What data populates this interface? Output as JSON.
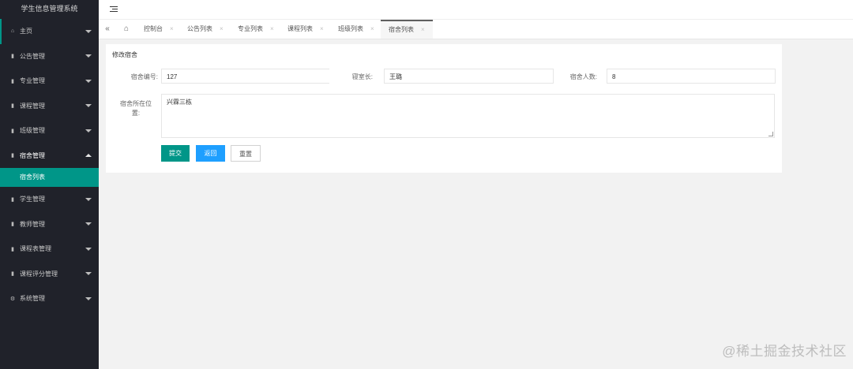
{
  "sidebar": {
    "title": "学生信息管理系统",
    "items": [
      {
        "icon": "⌂",
        "label": "主页"
      },
      {
        "icon": "▮",
        "label": "公告管理"
      },
      {
        "icon": "▮",
        "label": "专业管理"
      },
      {
        "icon": "▮",
        "label": "课程管理"
      },
      {
        "icon": "▮",
        "label": "班级管理"
      },
      {
        "icon": "▮",
        "label": "宿舍管理"
      },
      {
        "icon": "▮",
        "label": "学生管理"
      },
      {
        "icon": "▮",
        "label": "教师管理"
      },
      {
        "icon": "▮",
        "label": "课程表管理"
      },
      {
        "icon": "▮",
        "label": "课程评分管理"
      },
      {
        "icon": "⚙",
        "label": "系统管理"
      }
    ],
    "sub_active": "宿舍列表"
  },
  "tabs": {
    "prev_glyph": "«",
    "home_glyph": "⌂",
    "close_glyph": "×",
    "items": [
      "控制台",
      "公告列表",
      "专业列表",
      "课程列表",
      "班级列表",
      "宿舍列表"
    ]
  },
  "form": {
    "title": "修改宿舍",
    "labels": {
      "dorm_no": "宿舍编号:",
      "leader": "寝室长:",
      "count": "宿舍人数:",
      "location": "宿舍所在位置:"
    },
    "values": {
      "dorm_no": "127",
      "leader": "王璐",
      "count": "8",
      "location": "兴霖三栋"
    },
    "buttons": {
      "submit": "提交",
      "back": "返回",
      "reset": "重置"
    }
  },
  "watermark": "@稀土掘金技术社区",
  "colors": {
    "sidebar_bg": "#20222a",
    "accent": "#009688",
    "blue": "#1e9fff"
  }
}
